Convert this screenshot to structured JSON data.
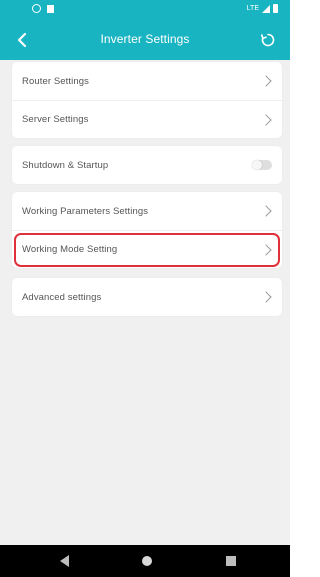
{
  "status_bar": {
    "network_label": "LTE"
  },
  "header": {
    "title": "Inverter Settings",
    "back_icon": "chevron-left-icon",
    "refresh_icon": "refresh-icon"
  },
  "groups": [
    {
      "items": [
        {
          "label": "Router Settings",
          "control": "chevron"
        },
        {
          "label": "Server Settings",
          "control": "chevron"
        }
      ]
    },
    {
      "items": [
        {
          "label": "Shutdown & Startup",
          "control": "toggle",
          "toggle_on": false
        }
      ]
    },
    {
      "items": [
        {
          "label": "Working Parameters Settings",
          "control": "chevron"
        },
        {
          "label": "Working Mode Setting",
          "control": "chevron",
          "highlighted": true
        }
      ]
    },
    {
      "items": [
        {
          "label": "Advanced settings",
          "control": "chevron"
        }
      ]
    }
  ],
  "colors": {
    "header_bg": "#19b4c2",
    "page_bg": "#f0f0f0",
    "highlight": "#e0303a"
  }
}
